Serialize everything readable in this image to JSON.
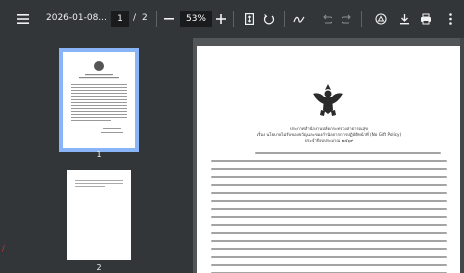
{
  "toolbar": {
    "menu_icon": "hamburger-menu-icon",
    "doc_title": "2026-01-08...",
    "current_page": "1",
    "page_separator": "/",
    "total_pages": "2",
    "zoom_out_icon": "minus-icon",
    "zoom_level": "53%",
    "zoom_in_icon": "plus-icon",
    "fit_icon": "fit-page-icon",
    "rotate_icon": "rotate-icon",
    "annotate_icon": "draw-pen-icon",
    "undo_icon": "undo-icon",
    "redo_icon": "redo-icon",
    "sign_icon": "sign-icon",
    "download_icon": "download-icon",
    "print_icon": "print-icon",
    "more_icon": "more-vert-icon"
  },
  "sidebar": {
    "thumbnails": [
      {
        "label": "1"
      },
      {
        "label": "2"
      }
    ]
  },
  "document": {
    "heading_line1": "ประกาศสำนักงานปลัดกระทรวงสาธารณสุข",
    "heading_line2": "เรื่อง นโยบายไม่รับของขวัญและของกำนัลจากการปฏิบัติหน้าที่ (No Gift Policy)",
    "heading_line3": "ประจำปีงบประมาณ ๒๕๖๙"
  },
  "colors": {
    "toolbar_bg": "#323639",
    "viewer_bg": "#525659",
    "selected_outline": "#8ab4f8"
  }
}
